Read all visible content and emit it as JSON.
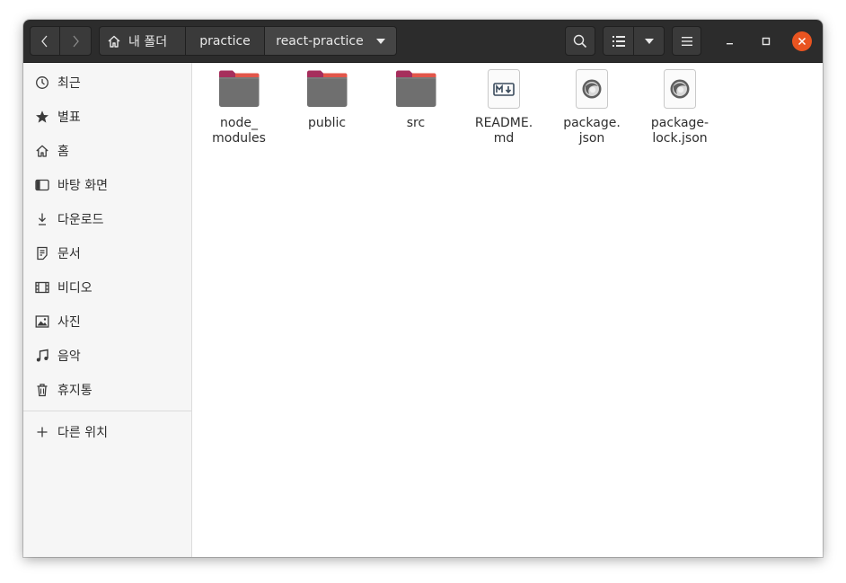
{
  "header": {
    "breadcrumb": [
      "내 폴더",
      "practice",
      "react-practice"
    ]
  },
  "sidebar": {
    "items": [
      {
        "label": "최근",
        "icon": "clock-icon"
      },
      {
        "label": "별표",
        "icon": "star-icon"
      },
      {
        "label": "홈",
        "icon": "home-icon"
      },
      {
        "label": "바탕 화면",
        "icon": "desktop-icon"
      },
      {
        "label": "다운로드",
        "icon": "download-icon"
      },
      {
        "label": "문서",
        "icon": "document-icon"
      },
      {
        "label": "비디오",
        "icon": "video-icon"
      },
      {
        "label": "사진",
        "icon": "picture-icon"
      },
      {
        "label": "음악",
        "icon": "music-icon"
      },
      {
        "label": "휴지통",
        "icon": "trash-icon"
      }
    ],
    "other_locations": {
      "label": "다른 위치",
      "icon": "plus-icon"
    }
  },
  "files": [
    {
      "name_line1": "node_",
      "name_line2": "modules",
      "type": "folder"
    },
    {
      "name_line1": "public",
      "name_line2": "",
      "type": "folder"
    },
    {
      "name_line1": "src",
      "name_line2": "",
      "type": "folder"
    },
    {
      "name_line1": "README.",
      "name_line2": "md",
      "type": "markdown"
    },
    {
      "name_line1": "package.",
      "name_line2": "json",
      "type": "json"
    },
    {
      "name_line1": "package-",
      "name_line2": "lock.json",
      "type": "json"
    }
  ],
  "colors": {
    "headerbar": "#2c2c2c",
    "folder_tab": "#a62e5c",
    "folder_body": "#6f6f6f",
    "close_button": "#e95420"
  }
}
